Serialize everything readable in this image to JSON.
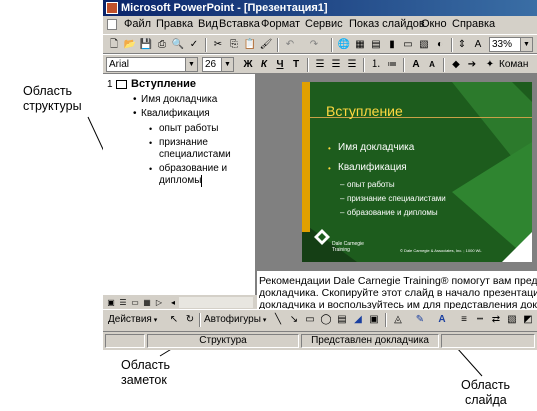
{
  "window": {
    "title": "Microsoft PowerPoint - [Презентация1]"
  },
  "menu": [
    "Файл",
    "Правка",
    "Вид",
    "Вставка",
    "Формат",
    "Сервис",
    "Показ слайдов",
    "Окно",
    "Справка"
  ],
  "format": {
    "font": "Arial",
    "size": "26",
    "bold": "Ж",
    "italic": "К",
    "underline": "Ч",
    "shadow": "Т",
    "zoom": "33%",
    "commands_label": "Коман"
  },
  "outline": {
    "slide_number": "1",
    "title": "Вступление",
    "items": [
      "Имя докладчика",
      "Квалификация"
    ],
    "subitems": [
      "опыт работы",
      "признание",
      "специалистами",
      "образование и",
      "дипломы"
    ]
  },
  "slide": {
    "title": "Вступление",
    "bullets": [
      "Имя докладчика",
      "Квалификация"
    ],
    "subbullets": [
      "опыт работы",
      "признание специалистами",
      "образование и дипломы"
    ],
    "logo_text": [
      "Dale Carnegie",
      "Training"
    ],
    "footer": "© Dale Carnegie & Associates, Inc. ; 1000 WL"
  },
  "notes": [
    "Рекомендации Dale Carnegie Training® помогут вам предст",
    "докладчика.  Скопируйте этот слайд в начало презентаци",
    "докладчика и воспользуйтесь им для представления докла"
  ],
  "drawing": {
    "actions": "Действия",
    "autoshapes": "Автофигуры"
  },
  "status": {
    "left": "Структура",
    "right": "Представлен докладчика"
  },
  "callouts": {
    "outline": [
      "Область",
      "структуры"
    ],
    "notes": [
      "Область",
      "заметок"
    ],
    "slide": [
      "Область",
      "слайда"
    ]
  }
}
